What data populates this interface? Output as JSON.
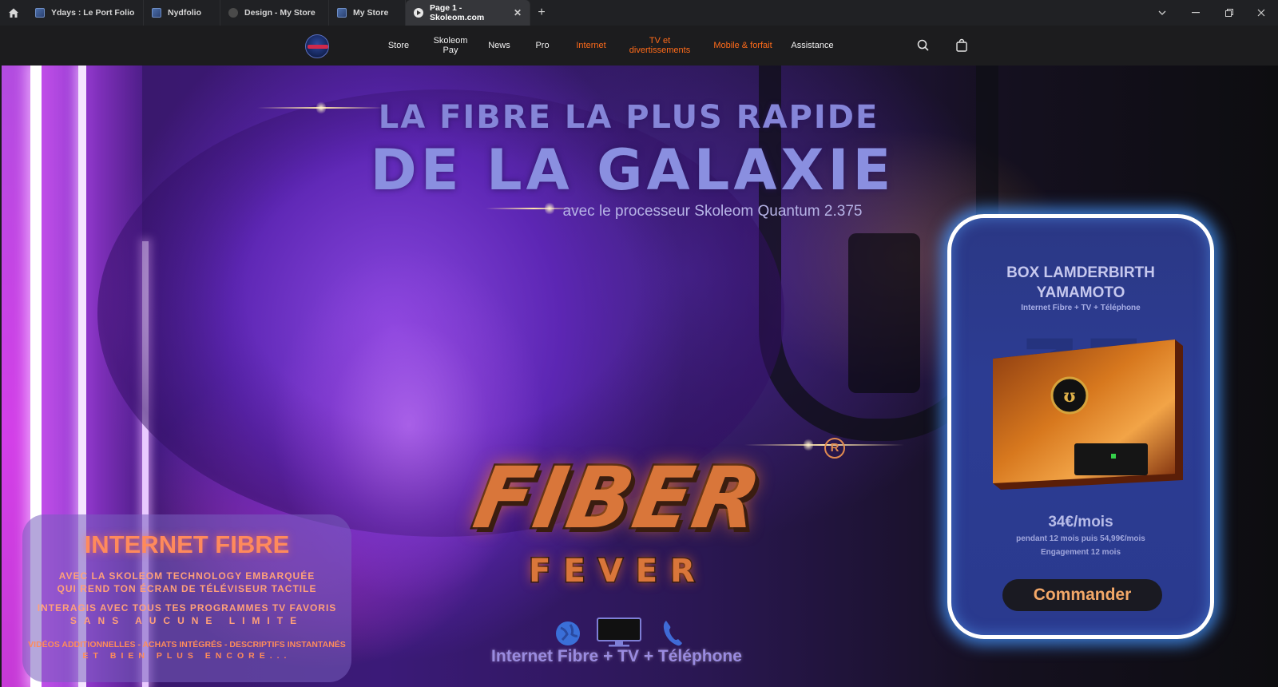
{
  "browser": {
    "tabs": [
      {
        "label": "Ydays : Le Port Folio",
        "favicon": "portfolio-icon"
      },
      {
        "label": "Nydfolio",
        "favicon": "portfolio-icon"
      },
      {
        "label": "Design - My Store",
        "favicon": "store-icon"
      },
      {
        "label": "My Store",
        "favicon": "portfolio-icon"
      },
      {
        "label": "Page 1 - Skoleom.com",
        "favicon": "play-icon",
        "active": true
      }
    ],
    "new_tab": "+",
    "close_tab": "✕"
  },
  "nav": {
    "items": [
      {
        "label": "Store",
        "highlight": false
      },
      {
        "label": "Skoleom Pay",
        "highlight": false
      },
      {
        "label": "News",
        "highlight": false
      },
      {
        "label": "Pro",
        "highlight": false
      },
      {
        "label": "Internet",
        "highlight": true
      },
      {
        "label": "TV et divertissements",
        "highlight": true
      },
      {
        "label": "Mobile & forfait",
        "highlight": true
      },
      {
        "label": "Assistance",
        "highlight": false
      }
    ],
    "highlight_color": "#ff6b1a"
  },
  "hero": {
    "headline_line1": "LA FIBRE LA PLUS RAPIDE",
    "headline_line2": "DE LA GALAXIE",
    "subheadline": "avec le processeur Skoleom Quantum 2.375",
    "logo_word1": "FIBER",
    "logo_word2": "FEVER",
    "registered_mark": "R",
    "tagline": "Internet Fibre + TV + Téléphone",
    "service_icons": [
      "globe-icon",
      "tv-icon",
      "phone-icon"
    ]
  },
  "info_card": {
    "title": "INTERNET FIBRE",
    "line1": "AVEC LA SKOLEOM TECHNOLOGY EMBARQUÉE",
    "line2": "QUI REND TON ÉCRAN DE TÉLÉVISEUR TACTILE",
    "line3": "INTERAGIS AVEC TOUS TES PROGRAMMES TV FAVORIS",
    "line4": "SANS AUCUNE LIMITE",
    "line5": "VIDÉOS ADDITIONNELLES - ACHATS INTÉGRÉS - DESCRIPTIFS INSTANTANÉS",
    "line6": "ET BIEN PLUS ENCORE..."
  },
  "product": {
    "title_line1": "BOX LAMDERBIRTH",
    "title_line2": "YAMAMOTO",
    "subtitle": "Internet Fibre + TV + Téléphone",
    "price": "34€/mois",
    "price_detail": "pendant 12 mois puis 54,99€/mois",
    "commitment": "Engagement 12 mois",
    "cta": "Commander",
    "accent_color": "#4a9cff"
  }
}
